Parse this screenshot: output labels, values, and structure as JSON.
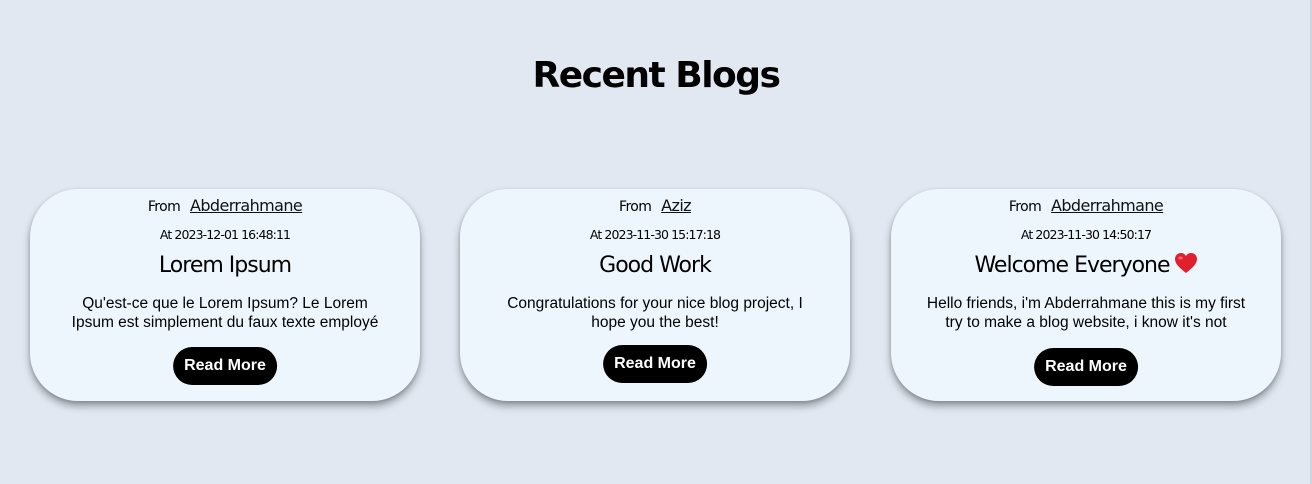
{
  "page": {
    "title": "Recent Blogs"
  },
  "colors": {
    "background": "#e1e8f2",
    "card": "#eef6fd",
    "button": "#000000",
    "button_text": "#ffffff",
    "heart": "#e0202c"
  },
  "blogs": [
    {
      "from_label": "From",
      "author": "Abderrahmane",
      "date": "At 2023-12-01 16:48:11",
      "title": "Lorem Ipsum",
      "excerpt": "Qu'est-ce que le Lorem Ipsum? Le Lorem Ipsum est simplement du faux texte employé",
      "button_label": "Read More"
    },
    {
      "from_label": "From",
      "author": "Aziz",
      "date": "At 2023-11-30 15:17:18",
      "title": "Good Work",
      "excerpt": "Congratulations for your nice blog project, I hope you the best!",
      "button_label": "Read More"
    },
    {
      "from_label": "From",
      "author": "Abderrahmane",
      "date": "At 2023-11-30 14:50:17",
      "title": "Welcome Everyone",
      "title_icon": "heart-icon",
      "excerpt": "Hello friends, i'm Abderrahmane this is my first try to make a blog website, i know it's not",
      "button_label": "Read More"
    }
  ]
}
